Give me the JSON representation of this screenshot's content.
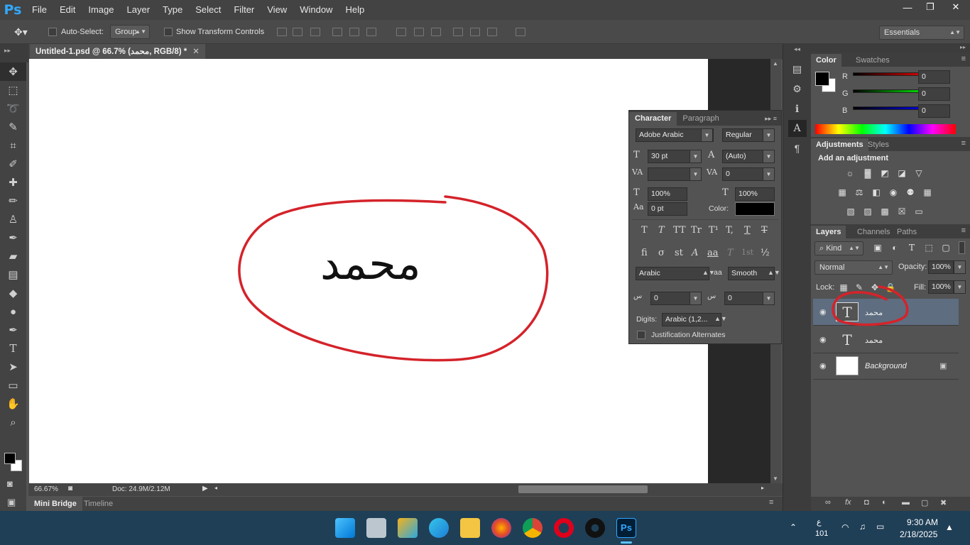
{
  "app": {
    "logo": "Ps"
  },
  "menu": [
    "File",
    "Edit",
    "Image",
    "Layer",
    "Type",
    "Select",
    "Filter",
    "View",
    "Window",
    "Help"
  ],
  "window_controls": {
    "minimize": "—",
    "restore": "❐",
    "close": "✕"
  },
  "options": {
    "tool_icon": "move-tool-icon",
    "auto_select_label": "Auto-Select:",
    "auto_select_value": "Group",
    "show_transform_label": "Show Transform Controls",
    "workspace": "Essentials"
  },
  "document": {
    "tab_title": "Untitled-1.psd @ 66.7% (محمد, RGB/8) *",
    "canvas_text": "محمد",
    "annotation_color": "#d4232a"
  },
  "status": {
    "zoom": "66.67%",
    "doc": "Doc: 24.9M/2.12M"
  },
  "bottom_tabs": {
    "mini_bridge": "Mini Bridge",
    "timeline": "Timeline"
  },
  "character": {
    "tab_character": "Character",
    "tab_paragraph": "Paragraph",
    "font_family": "Adobe Arabic",
    "font_style": "Regular",
    "size": "30 pt",
    "leading": "(Auto)",
    "kerning": "",
    "tracking": "0",
    "vscale": "100%",
    "hscale": "100%",
    "baseline": "0 pt",
    "color_label": "Color:",
    "color": "#000000",
    "language": "Arabic",
    "antialias_icon": "aa",
    "antialias": "Smooth",
    "diacritic_x": "0",
    "diacritic_y": "0",
    "digits_label": "Digits:",
    "digits": "Arabic (1,2...",
    "justification_label": "Justification Alternates",
    "style_buttons": [
      "T",
      "T",
      "TT",
      "Tr",
      "T¹",
      "T,",
      "T",
      "T"
    ],
    "opentype_buttons": [
      "fi",
      "σ",
      "st",
      "A",
      "aa",
      "T",
      "1st",
      "½"
    ]
  },
  "color_panel": {
    "tab_color": "Color",
    "tab_swatches": "Swatches",
    "r_label": "R",
    "g_label": "G",
    "b_label": "B",
    "r": "0",
    "g": "0",
    "b": "0",
    "fg": "#000000",
    "bg": "#ffffff"
  },
  "adjustments": {
    "tab_adjustments": "Adjustments",
    "tab_styles": "Styles",
    "heading": "Add an adjustment"
  },
  "layers_panel": {
    "tab_layers": "Layers",
    "tab_channels": "Channels",
    "tab_paths": "Paths",
    "filter_kind": "Kind",
    "blend_mode": "Normal",
    "opacity_label": "Opacity:",
    "opacity": "100%",
    "lock_label": "Lock:",
    "fill_label": "Fill:",
    "fill": "100%",
    "layers": [
      {
        "name": "محمد",
        "type": "text",
        "thumb": "T",
        "selected": true
      },
      {
        "name": "محمد",
        "type": "text",
        "thumb": "T",
        "selected": false
      },
      {
        "name": "Background",
        "type": "background",
        "thumb": "",
        "selected": false
      }
    ]
  },
  "taskbar": {
    "lang_top": "ع",
    "lang_bottom": "101",
    "time": "9:30 AM",
    "date": "2/18/2025"
  }
}
